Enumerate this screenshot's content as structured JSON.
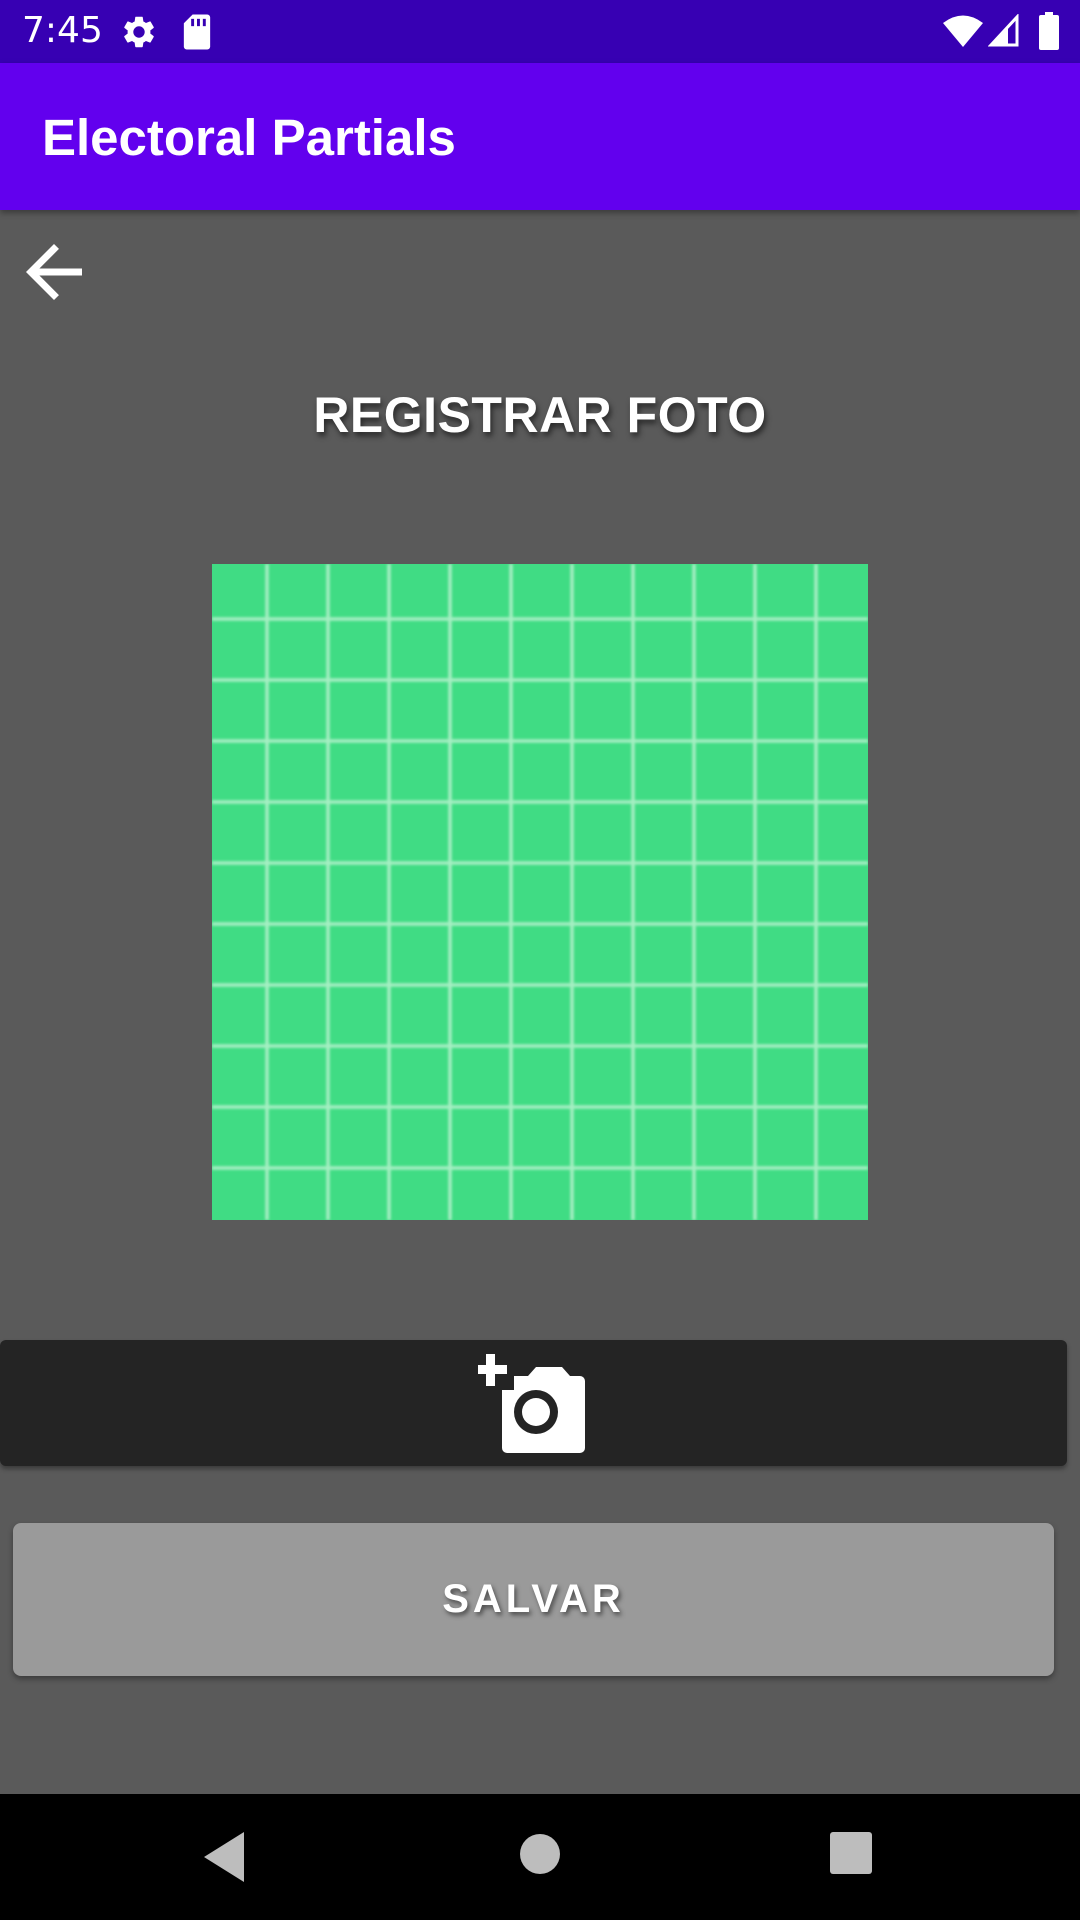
{
  "status_bar": {
    "time": "7:45",
    "icons": [
      "gear-icon",
      "sd-card-icon",
      "wifi-icon",
      "signal-icon",
      "battery-icon"
    ]
  },
  "app_bar": {
    "title": "Electoral Partials",
    "color": "#6200ee"
  },
  "toolbar": {
    "back_icon": "arrow-left-icon"
  },
  "main": {
    "heading": "REGISTRAR FOTO",
    "photo_placeholder_color": "#40dc84",
    "camera_button_icon": "add-a-photo-icon",
    "save_label": "SALVAR"
  },
  "nav_bar": {
    "icons": [
      "nav-back-icon",
      "nav-home-icon",
      "nav-recents-icon"
    ]
  },
  "colors": {
    "status_bar": "#3700b3",
    "background": "#5a5a5a",
    "camera_button": "#242424",
    "save_button": "#9a9a9a"
  }
}
